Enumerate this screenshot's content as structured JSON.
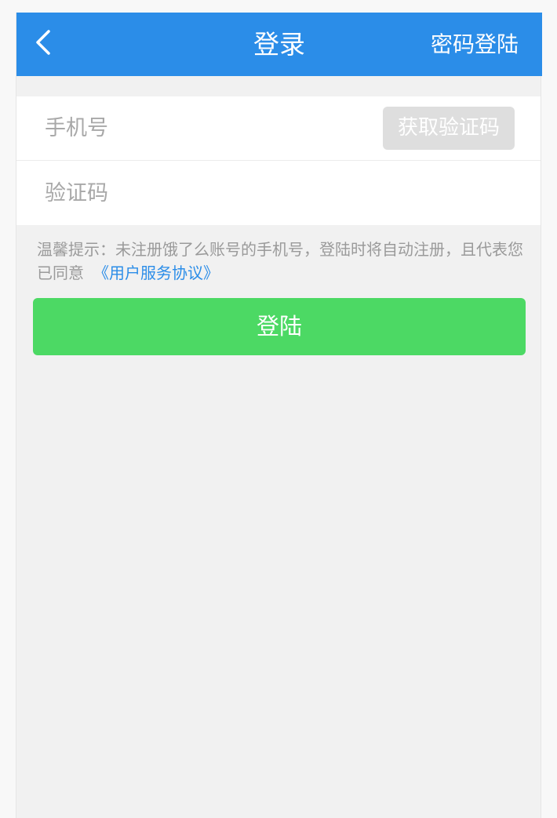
{
  "header": {
    "title": "登录",
    "right_label": "密码登陆",
    "back_icon": "chevron-left-icon",
    "background_color": "#2b8de8"
  },
  "form": {
    "phone_placeholder": "手机号",
    "phone_value": "",
    "code_button_label": "获取验证码",
    "code_placeholder": "验证码",
    "code_value": ""
  },
  "tip": {
    "text": "温馨提示：未注册饿了么账号的手机号，登陆时将自动注册，且代表您已同意",
    "link_label": "《用户服务协议》"
  },
  "login_button": {
    "label": "登陆",
    "color": "#4cd964"
  }
}
